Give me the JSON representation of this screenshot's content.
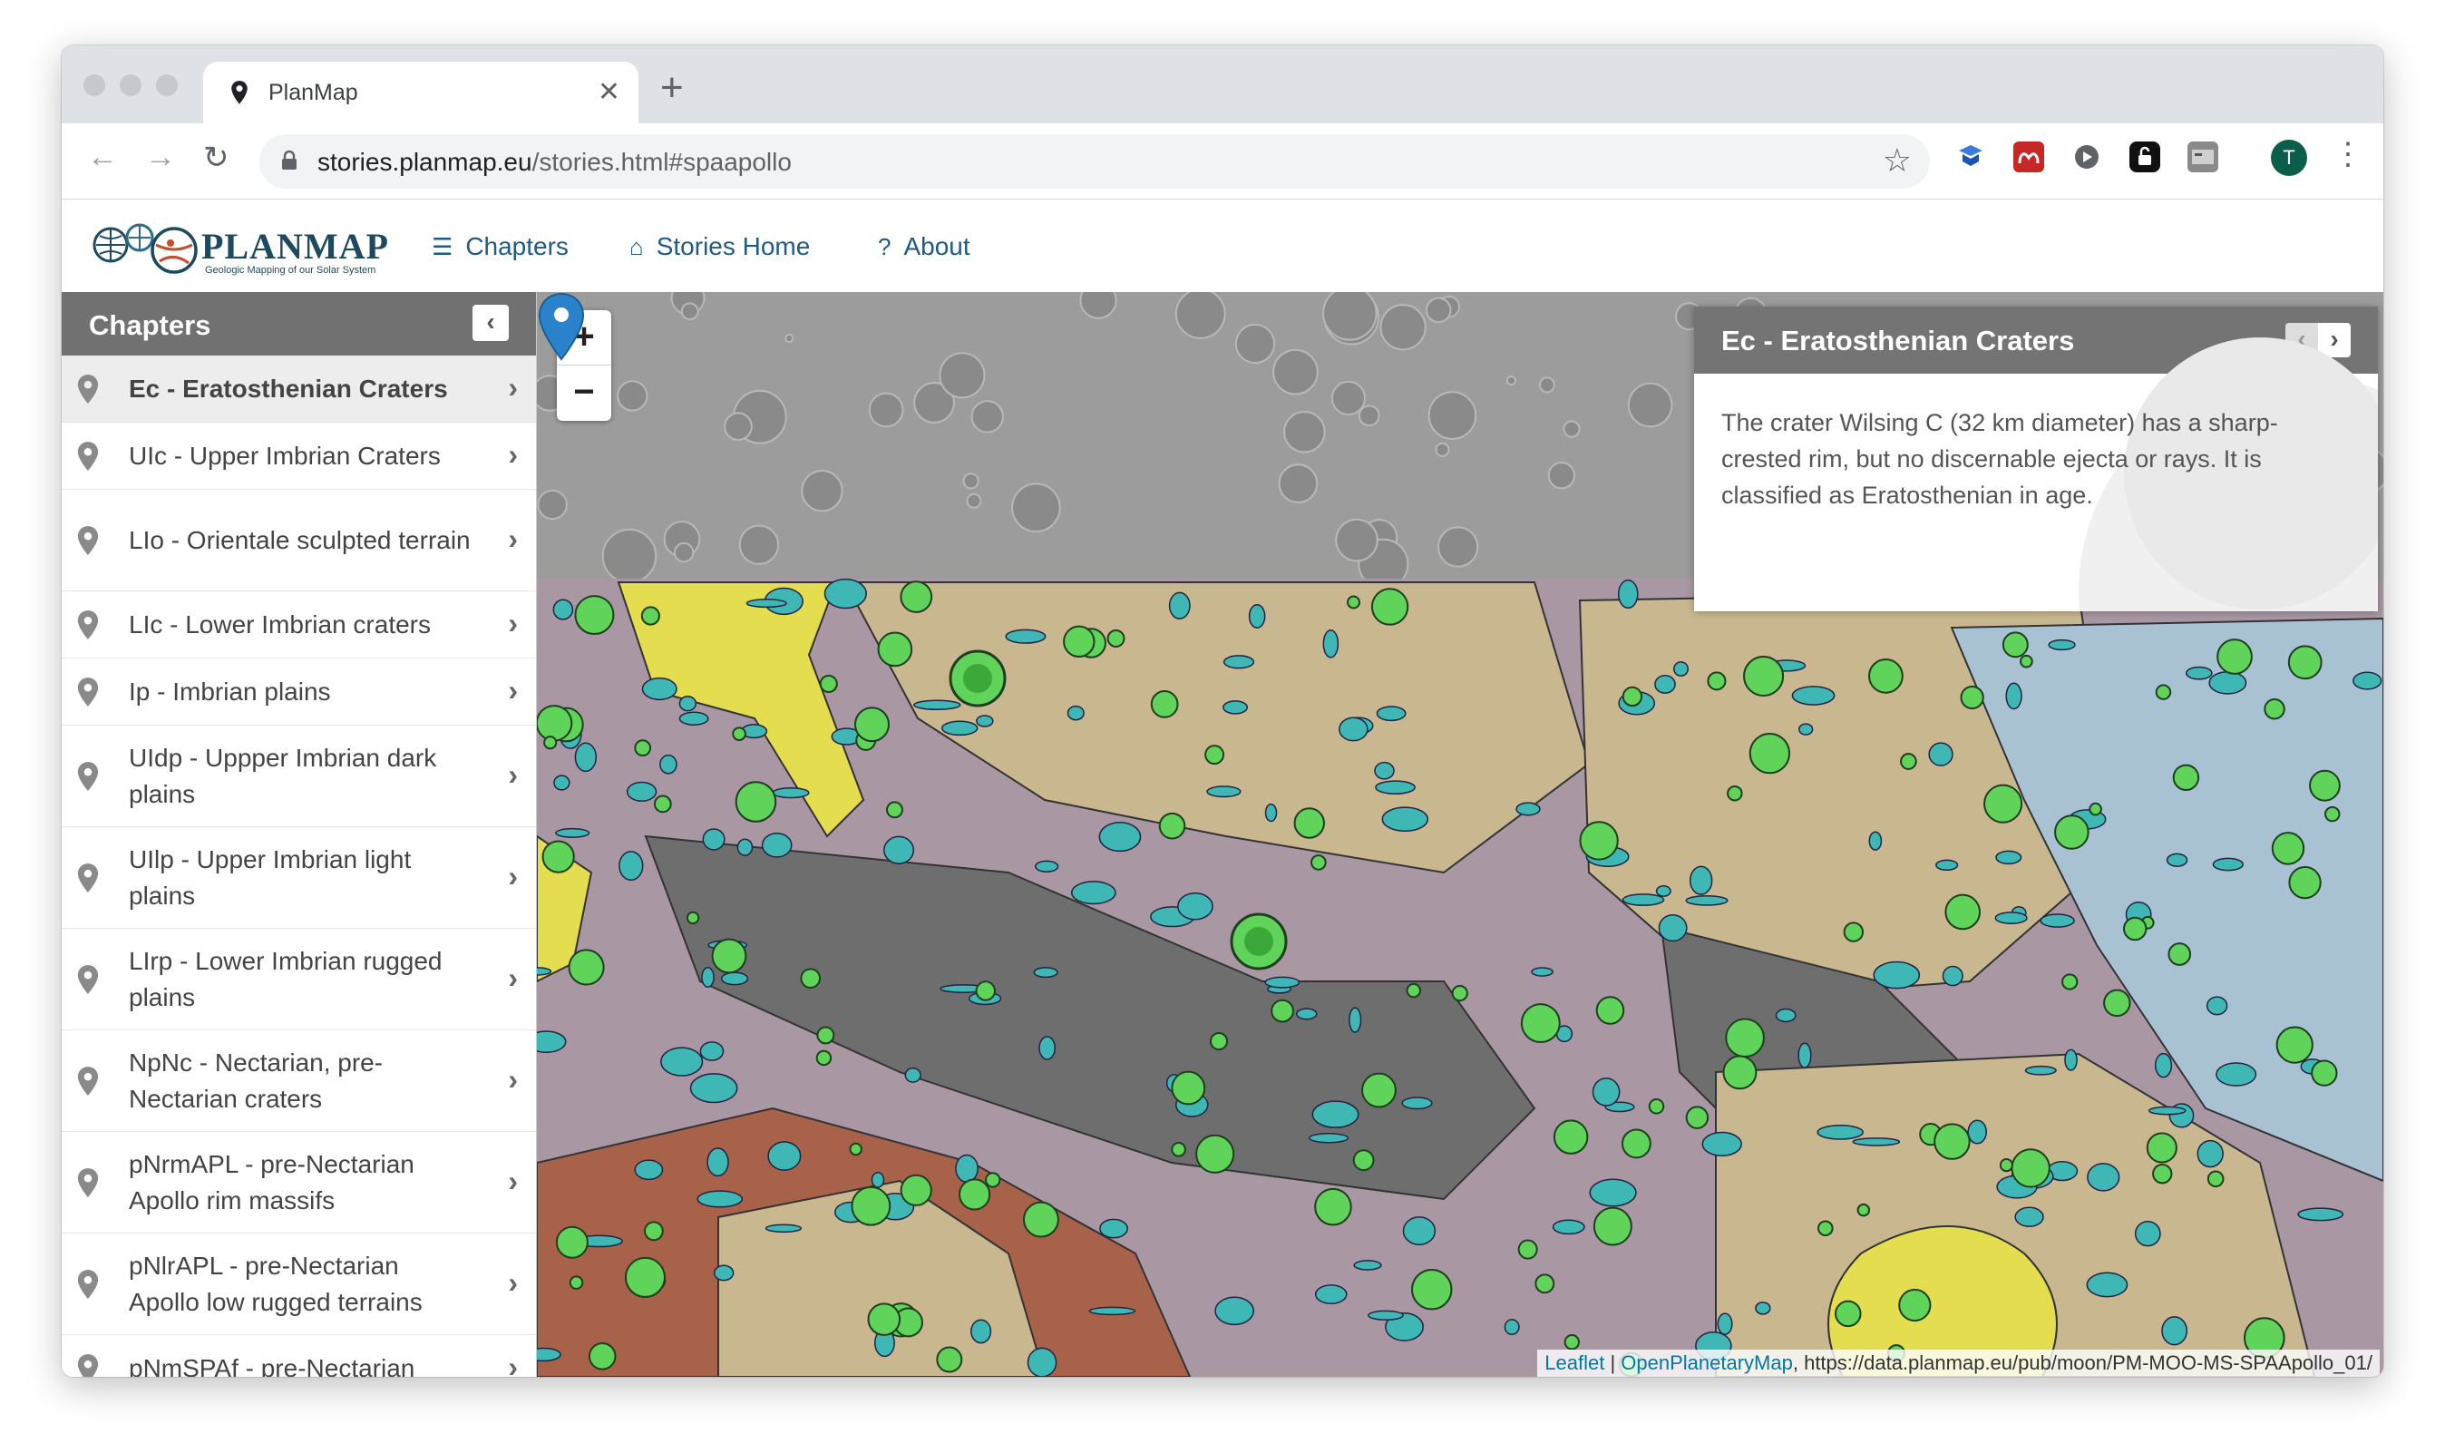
{
  "browser": {
    "tab_title": "PlanMap",
    "new_tab": "+",
    "close": "✕",
    "url_host": "stories.planmap.eu",
    "url_path": "/stories.html#spaapollo",
    "profile_initial": "T"
  },
  "site": {
    "logo_text": "PLANMAP",
    "logo_sub": "Geologic Mapping of our Solar System",
    "nav": [
      {
        "label": "Chapters",
        "icon": "list-icon"
      },
      {
        "label": "Stories Home",
        "icon": "home-icon"
      },
      {
        "label": "About",
        "icon": "question-circle-icon"
      }
    ]
  },
  "sidebar": {
    "title": "Chapters",
    "items": [
      {
        "label": "Ec - Eratosthenian Craters",
        "active": true
      },
      {
        "label": "UIc - Upper Imbrian Craters"
      },
      {
        "label": "LIo - Orientale sculpted terrain"
      },
      {
        "label": "LIc - Lower Imbrian craters"
      },
      {
        "label": "Ip - Imbrian plains"
      },
      {
        "label": "UIdp - Uppper Imbrian dark plains"
      },
      {
        "label": "UIlp - Upper Imbrian light plains"
      },
      {
        "label": "LIrp - Lower Imbrian rugged plains"
      },
      {
        "label": "NpNc - Nectarian, pre-Nectarian craters"
      },
      {
        "label": "pNrmAPL - pre-Nectarian Apollo rim massifs"
      },
      {
        "label": "pNlrAPL - pre-Nectarian Apollo low rugged terrains"
      },
      {
        "label": "pNmSPAf - pre-Nectarian"
      }
    ]
  },
  "map": {
    "zoom_in": "+",
    "zoom_out": "−",
    "story": {
      "title": "Ec - Eratosthenian Craters",
      "text": "The crater Wilsing C (32 km diameter) has a sharp-crested rim, but no discernable ejecta or rays. It is classified as Eratosthenian in age."
    },
    "attribution": {
      "leaflet": "Leaflet",
      "sep": " | ",
      "opm": "OpenPlanetaryMap",
      "source": ", https://data.planmap.eu/pub/moon/PM-MOO-MS-SPAApollo_01/"
    }
  },
  "colors": {
    "ec_green": "#5fd35a",
    "cyan_unit": "#3fb7b4",
    "tan_unit": "#c9b88f",
    "mauve_unit": "#a998a3",
    "dark_unit": "#6e6e6e",
    "brown_unit": "#a8624a",
    "blue_unit": "#a9c2d3",
    "yellow_unit": "#e3dd4f",
    "marker_blue": "#2a82cb"
  }
}
